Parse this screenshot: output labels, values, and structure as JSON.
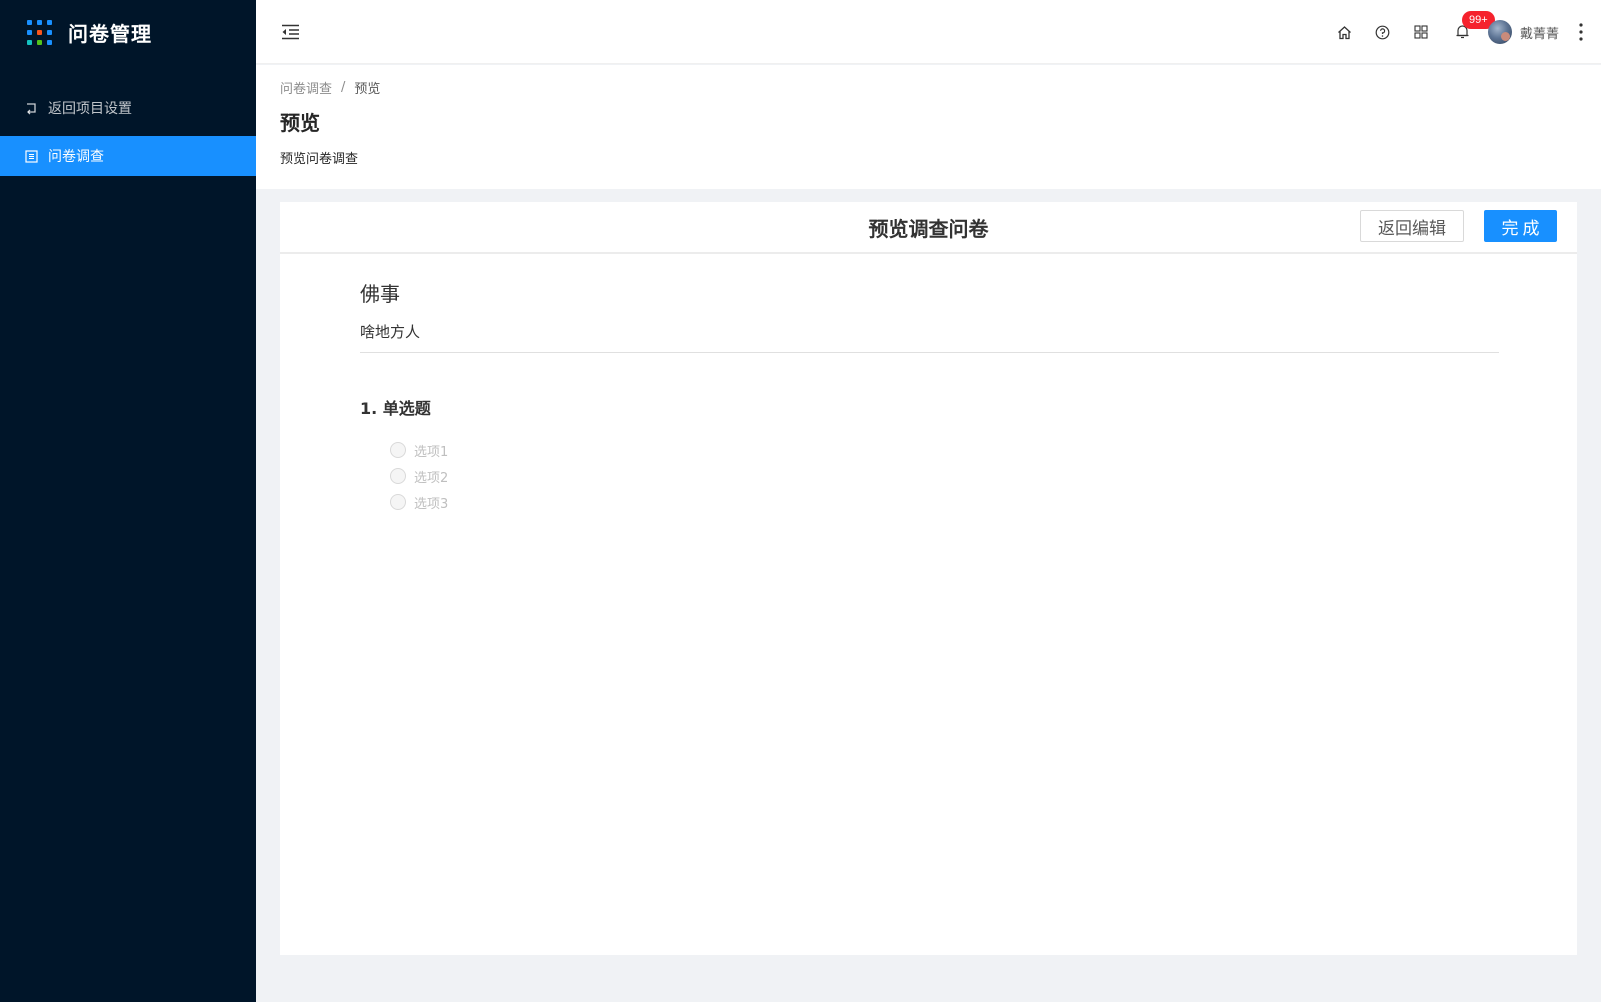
{
  "app": {
    "title": "问卷管理"
  },
  "sidebar": {
    "items": [
      {
        "label": "返回项目设置",
        "icon": "return-icon",
        "active": false
      },
      {
        "label": "问卷调查",
        "icon": "list-icon",
        "active": true
      }
    ]
  },
  "header": {
    "notification_badge": "99+",
    "username": "戴菁菁"
  },
  "page": {
    "breadcrumb": [
      "问卷调查",
      "预览"
    ],
    "breadcrumb_sep": "/",
    "title": "预览",
    "description": "预览问卷调查"
  },
  "card": {
    "title": "预览调查问卷",
    "back_button": "返回编辑",
    "done_button": "完成"
  },
  "survey": {
    "name": "佛事",
    "description": "啥地方人",
    "questions": [
      {
        "title": "1. 单选题",
        "options": [
          "选项1",
          "选项2",
          "选项3"
        ]
      }
    ]
  },
  "colors": {
    "sidebar_bg": "#001529",
    "primary": "#1890ff",
    "badge": "#f5222d"
  }
}
